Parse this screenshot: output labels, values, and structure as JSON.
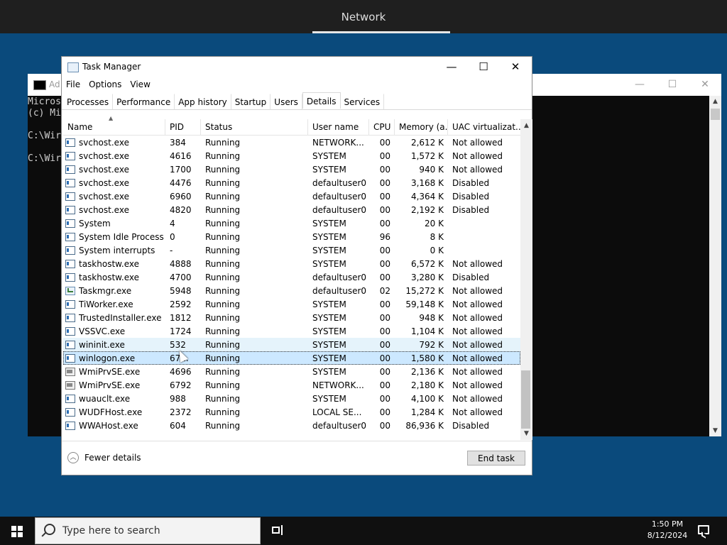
{
  "top_banner": {
    "title": "Network"
  },
  "cmd": {
    "title": "Ad",
    "controls": [
      "—",
      "☐",
      "✕"
    ],
    "lines": [
      "Micros",
      "(c) Mi",
      "",
      "C:\\Wir",
      "",
      "C:\\Wir"
    ]
  },
  "taskmanager": {
    "title": "Task Manager",
    "controls": {
      "minimize": "—",
      "maximize": "☐",
      "close": "✕"
    },
    "menu": [
      "File",
      "Options",
      "View"
    ],
    "tabs": [
      "Processes",
      "Performance",
      "App history",
      "Startup",
      "Users",
      "Details",
      "Services"
    ],
    "active_tab": "Details",
    "columns": [
      "Name",
      "PID",
      "Status",
      "User name",
      "CPU",
      "Memory (a...",
      "UAC virtualizat..."
    ],
    "rows": [
      {
        "name": "svchost.exe",
        "pid": "384",
        "status": "Running",
        "user": "NETWORK...",
        "cpu": "00",
        "mem": "2,612 K",
        "uac": "Not allowed",
        "icon": "process-icon"
      },
      {
        "name": "svchost.exe",
        "pid": "4616",
        "status": "Running",
        "user": "SYSTEM",
        "cpu": "00",
        "mem": "1,572 K",
        "uac": "Not allowed",
        "icon": "process-icon"
      },
      {
        "name": "svchost.exe",
        "pid": "1700",
        "status": "Running",
        "user": "SYSTEM",
        "cpu": "00",
        "mem": "940 K",
        "uac": "Not allowed",
        "icon": "process-icon"
      },
      {
        "name": "svchost.exe",
        "pid": "4476",
        "status": "Running",
        "user": "defaultuser0",
        "cpu": "00",
        "mem": "3,168 K",
        "uac": "Disabled",
        "icon": "process-icon"
      },
      {
        "name": "svchost.exe",
        "pid": "6960",
        "status": "Running",
        "user": "defaultuser0",
        "cpu": "00",
        "mem": "4,364 K",
        "uac": "Disabled",
        "icon": "process-icon"
      },
      {
        "name": "svchost.exe",
        "pid": "4820",
        "status": "Running",
        "user": "defaultuser0",
        "cpu": "00",
        "mem": "2,192 K",
        "uac": "Disabled",
        "icon": "process-icon"
      },
      {
        "name": "System",
        "pid": "4",
        "status": "Running",
        "user": "SYSTEM",
        "cpu": "00",
        "mem": "20 K",
        "uac": "",
        "icon": "process-icon"
      },
      {
        "name": "System Idle Process",
        "pid": "0",
        "status": "Running",
        "user": "SYSTEM",
        "cpu": "96",
        "mem": "8 K",
        "uac": "",
        "icon": "process-icon"
      },
      {
        "name": "System interrupts",
        "pid": "-",
        "status": "Running",
        "user": "SYSTEM",
        "cpu": "00",
        "mem": "0 K",
        "uac": "",
        "icon": "process-icon"
      },
      {
        "name": "taskhostw.exe",
        "pid": "4888",
        "status": "Running",
        "user": "SYSTEM",
        "cpu": "00",
        "mem": "6,572 K",
        "uac": "Not allowed",
        "icon": "process-icon"
      },
      {
        "name": "taskhostw.exe",
        "pid": "4700",
        "status": "Running",
        "user": "defaultuser0",
        "cpu": "00",
        "mem": "3,280 K",
        "uac": "Disabled",
        "icon": "process-icon"
      },
      {
        "name": "Taskmgr.exe",
        "pid": "5948",
        "status": "Running",
        "user": "defaultuser0",
        "cpu": "02",
        "mem": "15,272 K",
        "uac": "Not allowed",
        "icon": "taskmgr-icon"
      },
      {
        "name": "TiWorker.exe",
        "pid": "2592",
        "status": "Running",
        "user": "SYSTEM",
        "cpu": "00",
        "mem": "59,148 K",
        "uac": "Not allowed",
        "icon": "process-icon"
      },
      {
        "name": "TrustedInstaller.exe",
        "pid": "1812",
        "status": "Running",
        "user": "SYSTEM",
        "cpu": "00",
        "mem": "948 K",
        "uac": "Not allowed",
        "icon": "process-icon"
      },
      {
        "name": "VSSVC.exe",
        "pid": "1724",
        "status": "Running",
        "user": "SYSTEM",
        "cpu": "00",
        "mem": "1,104 K",
        "uac": "Not allowed",
        "icon": "process-icon"
      },
      {
        "name": "wininit.exe",
        "pid": "532",
        "status": "Running",
        "user": "SYSTEM",
        "cpu": "00",
        "mem": "792 K",
        "uac": "Not allowed",
        "icon": "process-icon",
        "state": "hover"
      },
      {
        "name": "winlogon.exe",
        "pid": "67...",
        "status": "Running",
        "user": "SYSTEM",
        "cpu": "00",
        "mem": "1,580 K",
        "uac": "Not allowed",
        "icon": "process-icon",
        "state": "selected"
      },
      {
        "name": "WmiPrvSE.exe",
        "pid": "4696",
        "status": "Running",
        "user": "SYSTEM",
        "cpu": "00",
        "mem": "2,136 K",
        "uac": "Not allowed",
        "icon": "gear-process-icon"
      },
      {
        "name": "WmiPrvSE.exe",
        "pid": "6792",
        "status": "Running",
        "user": "NETWORK...",
        "cpu": "00",
        "mem": "2,180 K",
        "uac": "Not allowed",
        "icon": "gear-process-icon"
      },
      {
        "name": "wuauclt.exe",
        "pid": "988",
        "status": "Running",
        "user": "SYSTEM",
        "cpu": "00",
        "mem": "4,100 K",
        "uac": "Not allowed",
        "icon": "process-icon"
      },
      {
        "name": "WUDFHost.exe",
        "pid": "2372",
        "status": "Running",
        "user": "LOCAL SE...",
        "cpu": "00",
        "mem": "1,284 K",
        "uac": "Not allowed",
        "icon": "process-icon"
      },
      {
        "name": "WWAHost.exe",
        "pid": "604",
        "status": "Running",
        "user": "defaultuser0",
        "cpu": "00",
        "mem": "86,936 K",
        "uac": "Disabled",
        "icon": "process-icon"
      }
    ],
    "fewer_details": "Fewer details",
    "end_task": "End task"
  },
  "taskbar": {
    "search_placeholder": "Type here to search",
    "time": "1:50 PM",
    "date": "8/12/2024"
  },
  "colors": {
    "desktop": "#0a4a7c",
    "taskbar": "#101010",
    "selection": "#cce8ff",
    "hover": "#e5f3fb"
  }
}
